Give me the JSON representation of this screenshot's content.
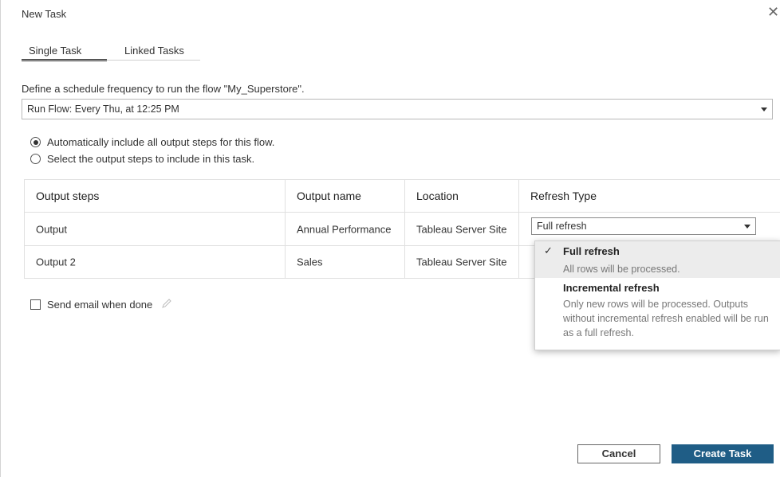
{
  "window": {
    "title": "New Task",
    "close_label": "✕"
  },
  "tabs": [
    {
      "label": "Single Task",
      "active": true
    },
    {
      "label": "Linked Tasks",
      "active": false
    }
  ],
  "description": "Define a schedule frequency to run the flow \"My_Superstore\".",
  "schedule": {
    "value": "Run Flow: Every Thu, at 12:25 PM"
  },
  "output_mode": {
    "options": [
      {
        "label": "Automatically include all output steps for this flow.",
        "selected": true
      },
      {
        "label": "Select the output steps to include in this task.",
        "selected": false
      }
    ]
  },
  "table": {
    "headers": [
      "Output steps",
      "Output name",
      "Location",
      "Refresh Type"
    ],
    "rows": [
      {
        "step": "Output",
        "name": "Annual Performance",
        "location": "Tableau Server Site",
        "refresh": "Full refresh"
      },
      {
        "step": "Output 2",
        "name": "Sales",
        "location": "Tableau Server Site",
        "refresh": ""
      }
    ]
  },
  "refresh_dropdown": {
    "options": [
      {
        "title": "Full refresh",
        "description": "All rows will be processed.",
        "selected": true,
        "check": "✓"
      },
      {
        "title": "Incremental refresh",
        "description": "Only new rows will be processed. Outputs without incremental refresh enabled will be run as a full refresh.",
        "selected": false
      }
    ]
  },
  "email": {
    "label": "Send email when done",
    "checked": false
  },
  "footer": {
    "cancel_label": "Cancel",
    "create_label": "Create Task"
  },
  "colors": {
    "primary": "#1f5d86",
    "border": "#e0e0e0"
  },
  "icons": {
    "close": "close-icon",
    "pencil": "pencil-icon",
    "check": "check-icon",
    "caret": "chevron-down-icon"
  }
}
